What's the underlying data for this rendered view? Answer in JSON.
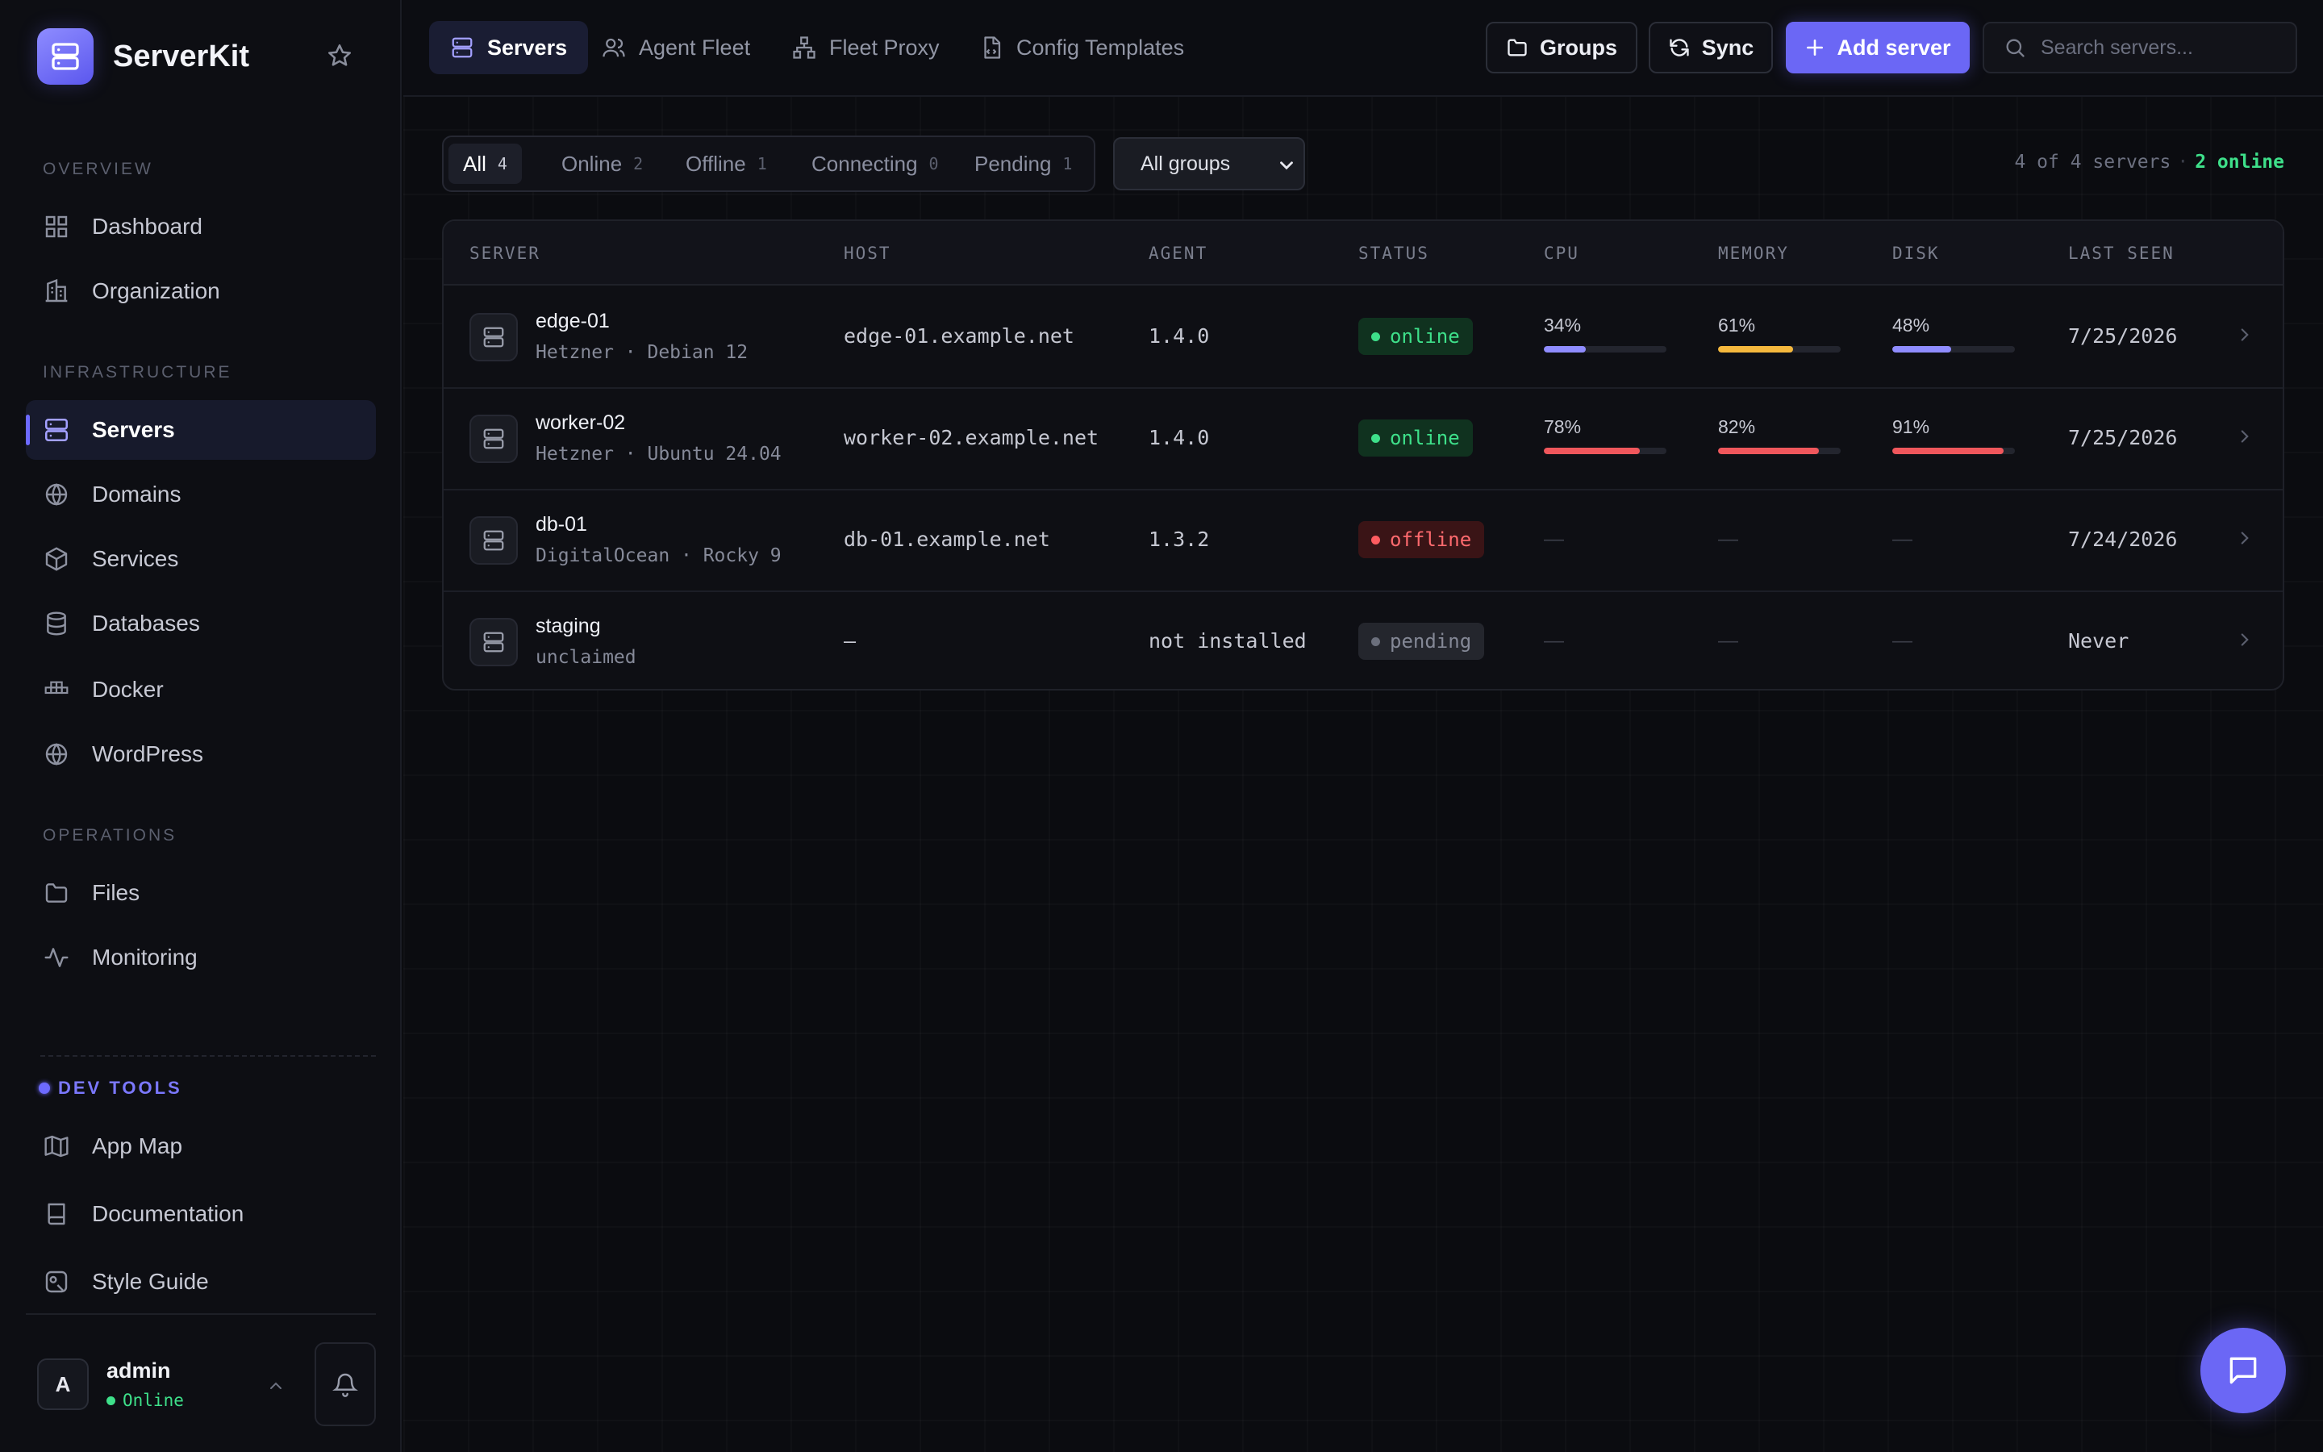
{
  "brand": {
    "name": "ServerKit"
  },
  "sidebar": {
    "sections": {
      "overview": "OVERVIEW",
      "infrastructure": "INFRASTRUCTURE",
      "operations": "OPERATIONS",
      "devtools": "DEV TOOLS"
    },
    "items": {
      "dashboard": "Dashboard",
      "organization": "Organization",
      "servers": "Servers",
      "domains": "Domains",
      "services": "Services",
      "databases": "Databases",
      "docker": "Docker",
      "wordpress": "WordPress",
      "files": "Files",
      "monitoring": "Monitoring",
      "appmap": "App Map",
      "documentation": "Documentation",
      "styleguide": "Style Guide"
    },
    "active": "servers",
    "icons": [
      "grid-icon",
      "building-icon",
      "server-icon",
      "globe-icon",
      "cube-icon",
      "database-icon",
      "docker-icon",
      "wordpress-icon",
      "folder-icon",
      "activity-icon",
      "map-icon",
      "book-icon",
      "palette-icon"
    ]
  },
  "user": {
    "avatar": "A",
    "name": "admin",
    "status": "Online"
  },
  "tabs": {
    "servers": "Servers",
    "fleet": "Agent Fleet",
    "proxy": "Fleet Proxy",
    "templates": "Config Templates"
  },
  "toolbar": {
    "groups": "Groups",
    "sync": "Sync",
    "add": "Add server",
    "search_placeholder": "Search servers..."
  },
  "filters": [
    {
      "label": "All",
      "count": "4"
    },
    {
      "label": "Online",
      "count": "2"
    },
    {
      "label": "Offline",
      "count": "1"
    },
    {
      "label": "Connecting",
      "count": "0"
    },
    {
      "label": "Pending",
      "count": "1"
    }
  ],
  "group_select": "All groups",
  "summary": {
    "count": "4 of 4 servers",
    "sep": "·",
    "online": "2 online"
  },
  "columns": {
    "server": "SERVER",
    "host": "HOST",
    "agent": "AGENT",
    "status": "STATUS",
    "cpu": "CPU",
    "memory": "MEMORY",
    "disk": "DISK",
    "last_seen": "LAST SEEN"
  },
  "rows": [
    {
      "name": "edge-01",
      "sub": "Hetzner · Debian 12",
      "host": "edge-01.example.net",
      "agent": "1.4.0",
      "status": "online",
      "cpu": "34%",
      "mem": "61%",
      "disk": "48%",
      "cpu_v": 34,
      "mem_v": 61,
      "disk_v": 48,
      "last_seen": "7/25/2026"
    },
    {
      "name": "worker-02",
      "sub": "Hetzner · Ubuntu 24.04",
      "host": "worker-02.example.net",
      "agent": "1.4.0",
      "status": "online",
      "cpu": "78%",
      "mem": "82%",
      "disk": "91%",
      "cpu_v": 78,
      "mem_v": 82,
      "disk_v": 91,
      "last_seen": "7/25/2026"
    },
    {
      "name": "db-01",
      "sub": "DigitalOcean · Rocky 9",
      "host": "db-01.example.net",
      "agent": "1.3.2",
      "status": "offline",
      "cpu": "—",
      "mem": "—",
      "disk": "—",
      "last_seen": "7/24/2026"
    },
    {
      "name": "staging",
      "sub": "unclaimed",
      "host": "—",
      "agent": "not installed",
      "status": "pending",
      "cpu": "—",
      "mem": "—",
      "disk": "—",
      "last_seen": "Never"
    }
  ],
  "colors": {
    "accent": "#6b67f5",
    "online": "#3ee08a",
    "offline": "#ff5c60",
    "bar_low": "#8f8cff",
    "bar_mid": "#f5b83d",
    "bar_high": "#f0575c"
  }
}
